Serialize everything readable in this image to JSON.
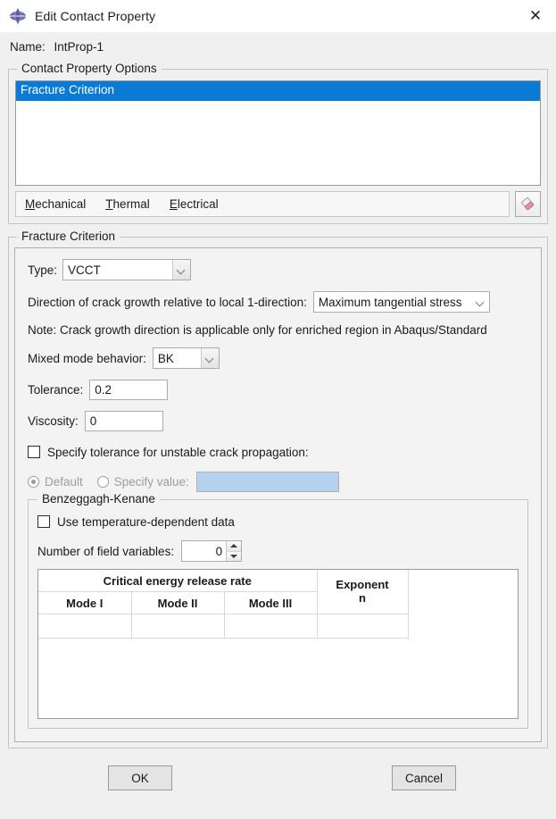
{
  "window": {
    "title": "Edit Contact Property",
    "icon": "abaqus-diamond-icon",
    "close_label": "✕"
  },
  "name_field": {
    "label": "Name:",
    "value": "IntProp-1"
  },
  "contact_property_options": {
    "group_title": "Contact Property Options",
    "list_items": [
      {
        "label": "Fracture Criterion",
        "selected": true
      }
    ],
    "menu": [
      {
        "label": "Mechanical",
        "mnemonic": "M"
      },
      {
        "label": "Thermal",
        "mnemonic": "T"
      },
      {
        "label": "Electrical",
        "mnemonic": "E"
      }
    ],
    "delete_button_icon": "eraser-icon"
  },
  "fracture_criterion": {
    "group_title": "Fracture Criterion",
    "type": {
      "label": "Type:",
      "value": "VCCT"
    },
    "direction": {
      "label": "Direction of crack growth relative to local 1-direction:",
      "value": "Maximum tangential stress"
    },
    "note": "Note: Crack growth direction is applicable only for enriched region in Abaqus/Standard",
    "mixed_mode": {
      "label": "Mixed mode behavior:",
      "value": "BK"
    },
    "tolerance": {
      "label": "Tolerance:",
      "value": "0.2"
    },
    "viscosity": {
      "label": "Viscosity:",
      "value": "0"
    },
    "unstable_tolerance": {
      "checkbox_label": "Specify tolerance for unstable crack propagation:",
      "checked": false,
      "default_radio_label": "Default",
      "default_selected": true,
      "specify_radio_label": "Specify value:",
      "specify_selected": false,
      "specify_value": "",
      "disabled": true
    },
    "benzeggagh_kenane": {
      "group_title": "Benzeggagh-Kenane",
      "temp_dependent": {
        "label": "Use temperature-dependent data",
        "checked": false
      },
      "field_variables": {
        "label": "Number of field variables:",
        "value": "0"
      },
      "table": {
        "span_header": "Critical energy release rate",
        "exponent_header_line1": "Exponent",
        "exponent_header_line2": "n",
        "columns": [
          "Mode I",
          "Mode II",
          "Mode III"
        ],
        "rows": [
          {
            "mode_i": "",
            "mode_ii": "",
            "mode_iii": "",
            "exponent": ""
          }
        ]
      }
    }
  },
  "buttons": {
    "ok": "OK",
    "cancel": "Cancel"
  },
  "colors": {
    "selection_blue": "#0a7bd4",
    "disabled_field_blue": "#b6d1ed",
    "dialog_bg": "#f0f0f0",
    "panel_bg": "#f3f3f3"
  }
}
